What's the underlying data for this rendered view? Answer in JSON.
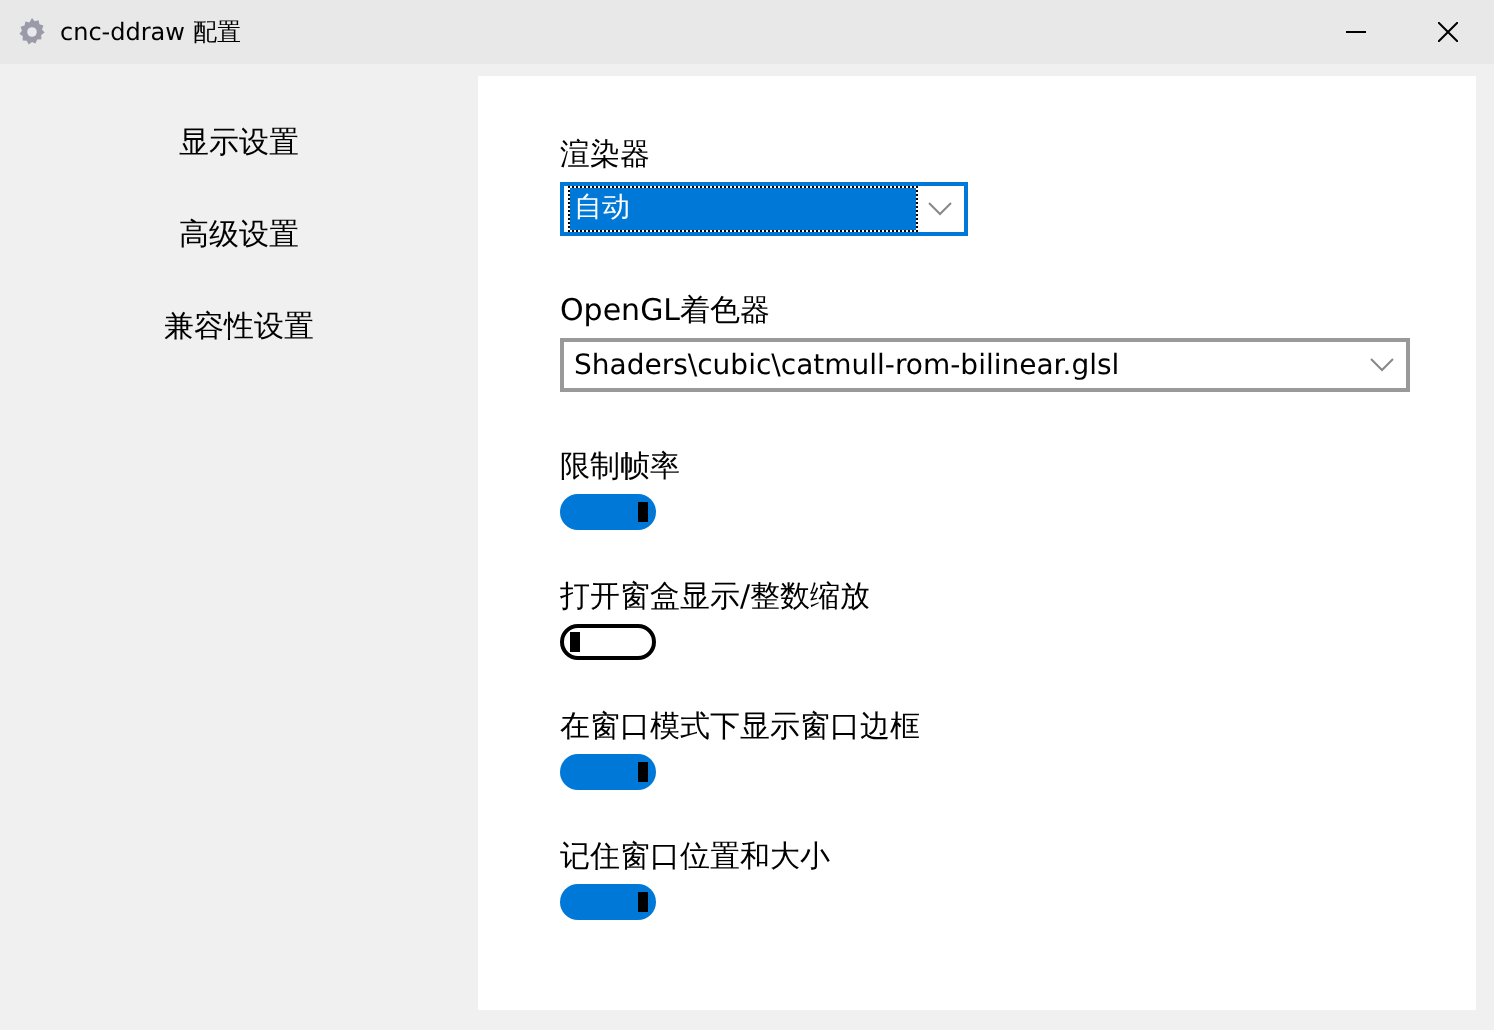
{
  "window": {
    "title": "cnc-ddraw 配置"
  },
  "sidebar": {
    "items": [
      {
        "label": "显示设置"
      },
      {
        "label": "高级设置"
      },
      {
        "label": "兼容性设置"
      }
    ]
  },
  "dropdowns": [
    {
      "label": "渲染器",
      "value": "自动",
      "focused": true
    },
    {
      "label": "OpenGL着色器",
      "value": "Shaders\\cubic\\catmull-rom-bilinear.glsl",
      "focused": false
    }
  ],
  "toggles": [
    {
      "label": "限制帧率",
      "on": true
    },
    {
      "label": "打开窗盒显示/整数缩放",
      "on": false
    },
    {
      "label": "在窗口模式下显示窗口边框",
      "on": true
    },
    {
      "label": "记住窗口位置和大小",
      "on": true
    }
  ]
}
